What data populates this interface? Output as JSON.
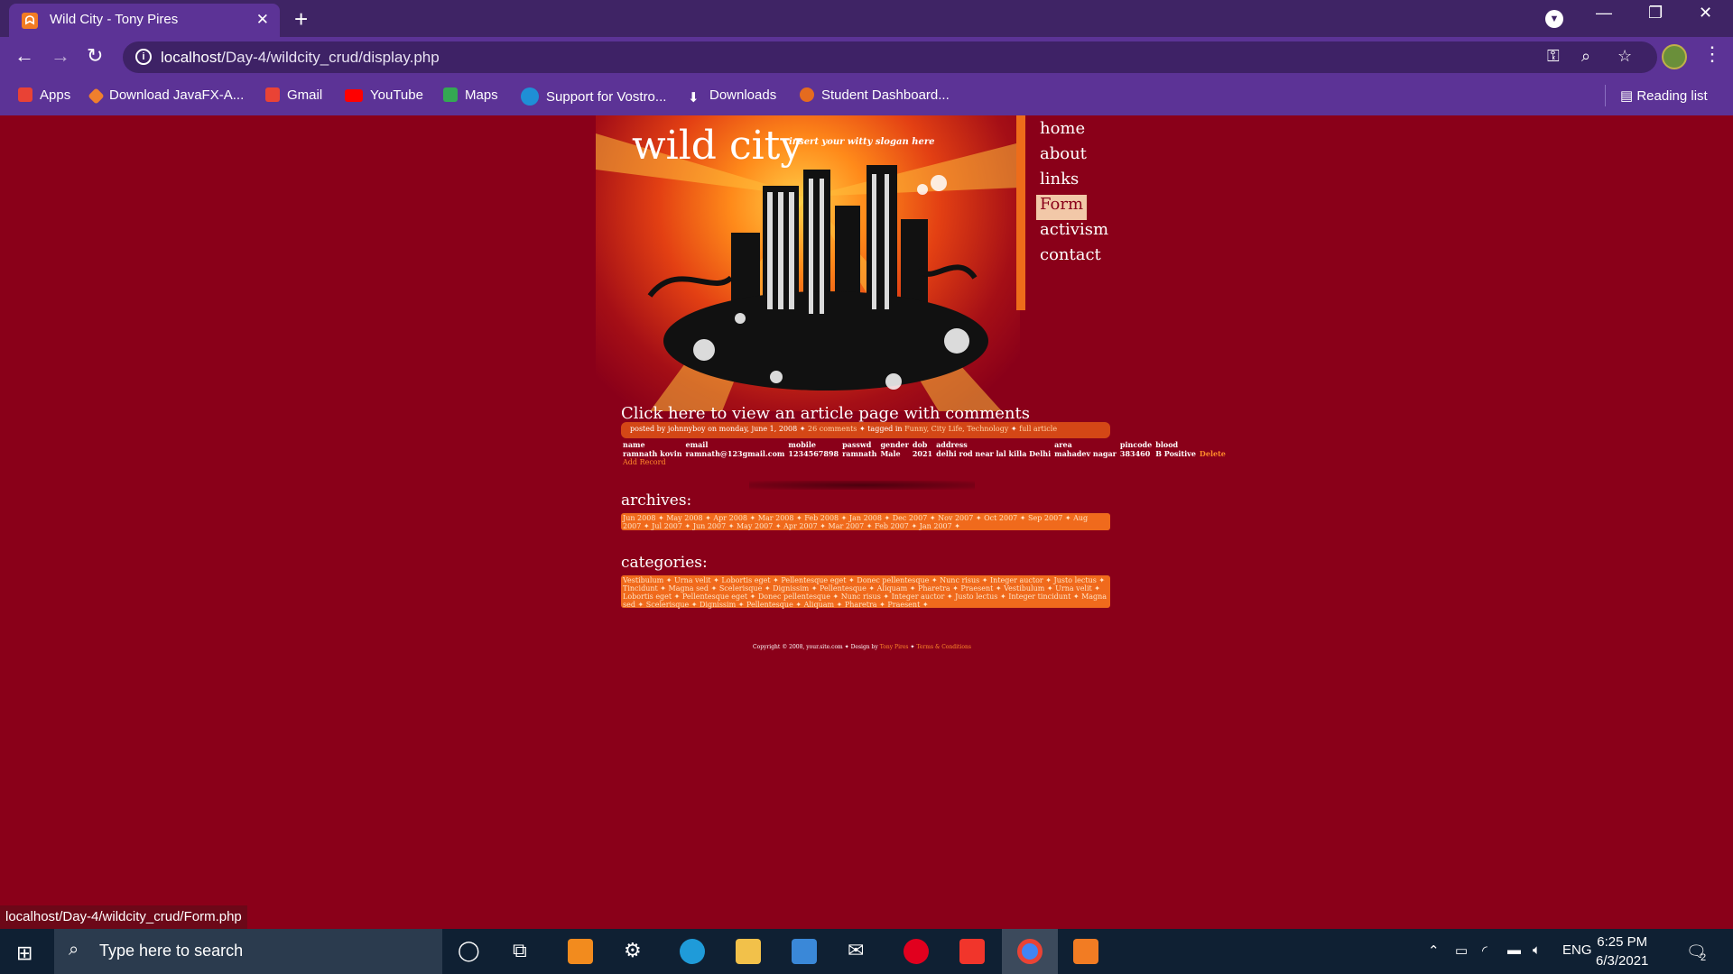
{
  "browser": {
    "tab_title": "Wild City - Tony Pires",
    "favicon_glyph": "ᗣ",
    "new_tab_glyph": "+",
    "close_glyph": "✕",
    "url_host": "localhost",
    "url_path": "/Day-4/wildcity_crud/display.php",
    "window_controls": [
      "—",
      "❐",
      "✕"
    ],
    "nav": {
      "back": "←",
      "forward": "→",
      "reload": "↻"
    },
    "bookmarks": [
      {
        "label": "Apps",
        "icon": "apps-grid-icon",
        "color": "#e94235"
      },
      {
        "label": "Download JavaFX-A...",
        "icon": "javafx-icon",
        "color": "#f07f2d"
      },
      {
        "label": "Gmail",
        "icon": "gmail-icon",
        "color": "#ea4335"
      },
      {
        "label": "YouTube",
        "icon": "youtube-icon",
        "color": "#ff0000"
      },
      {
        "label": "Maps",
        "icon": "maps-icon",
        "color": "#34a853"
      },
      {
        "label": "Support for Vostro...",
        "icon": "dell-icon",
        "color": "#1f8fd6"
      },
      {
        "label": "Downloads",
        "icon": "download-icon",
        "color": "#ffffff"
      },
      {
        "label": "Student Dashboard...",
        "icon": "student-dashboard-icon",
        "color": "#e56b1f"
      }
    ],
    "reading_list": "Reading list",
    "status_url": "localhost/Day-4/wildcity_crud/Form.php"
  },
  "site": {
    "logo": "wild city",
    "slogan": "insert your witty slogan here",
    "menu": [
      {
        "label": "home",
        "active": false
      },
      {
        "label": "about",
        "active": false
      },
      {
        "label": "links",
        "active": false
      },
      {
        "label": "Form",
        "active": true
      },
      {
        "label": "activism",
        "active": false
      },
      {
        "label": "contact",
        "active": false
      }
    ],
    "article_title": "Click here to view an article page with comments",
    "post_meta": {
      "posted": "posted by johnnyboy on monday, june 1, 2008",
      "comments": "26 comments",
      "tagged_prefix": "tagged in",
      "tags": "Funny, City Life, Technology",
      "full_article": "full article"
    },
    "table": {
      "headers": [
        "name",
        "email",
        "mobile",
        "passwd",
        "gender",
        "dob",
        "address",
        "area",
        "pincode",
        "blood"
      ],
      "rows": [
        [
          "ramnath kovin",
          "ramnath@123gmail.com",
          "1234567898",
          "ramnath",
          "Male",
          "2021",
          "delhi rod near lal killa Delhi",
          "mahadev nagar",
          "383460",
          "B Positive"
        ]
      ],
      "delete_label": "Delete",
      "add_record": "Add Record"
    },
    "archives": {
      "heading": "archives:",
      "text": "Jun 2008 ✦ May 2008 ✦ Apr 2008 ✦ Mar 2008 ✦ Feb 2008 ✦ Jan 2008 ✦ Dec 2007 ✦ Nov 2007 ✦ Oct 2007 ✦ Sep 2007 ✦ Aug 2007 ✦ Jul 2007 ✦ Jun 2007 ✦ May 2007 ✦ Apr 2007 ✦ Mar 2007 ✦ Feb 2007 ✦ Jan 2007 ✦"
    },
    "categories": {
      "heading": "categories:",
      "text": "Vestibulum ✦ Urna velit ✦ Lobortis eget ✦ Pellentesque eget ✦ Donec pellentesque ✦ Nunc risus ✦ Integer auctor ✦ Justo lectus ✦ Tincidunt ✦ Magna sed ✦ Scelerisque ✦ Dignissim ✦ Pellentesque ✦ Aliquam ✦ Pharetra ✦ Praesent ✦ Vestibulum ✦ Urna velit ✦ Lobortis eget ✦ Pellentesque eget ✦ Donec pellentesque ✦ Nunc risus ✦ Integer auctor ✦ Justo lectus ✦ Integer tincidunt ✦ Magna sed ✦ Scelerisque ✦ Dignissim ✦ Pellentesque ✦ Aliquam ✦ Pharetra ✦ Praesent ✦"
    },
    "footer": {
      "copyright": "Copyright © 2008, your.site.com ✦ Design by",
      "designer": "Tony Pires",
      "terms": "Terms & Conditions"
    }
  },
  "taskbar": {
    "search_placeholder": "Type here to search",
    "language": "ENG",
    "time": "6:25 PM",
    "date": "6/3/2021",
    "notification_count": "2"
  },
  "colors": {
    "page_bg": "#8a0019",
    "accent_orange": "#f06a1c",
    "browser_purple": "#5c3396"
  }
}
